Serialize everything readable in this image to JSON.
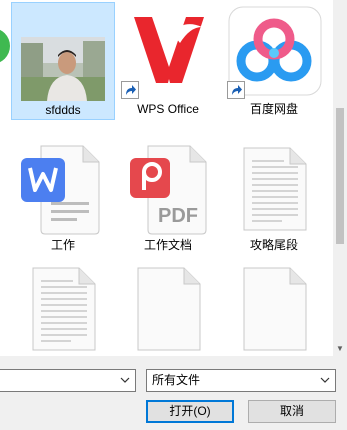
{
  "files": [
    {
      "name": "sfddds",
      "kind": "photo",
      "selected": true
    },
    {
      "name": "WPS Office",
      "kind": "app-shortcut",
      "icon": "wps-office-icon"
    },
    {
      "name": "百度网盘",
      "kind": "app-shortcut",
      "icon": "baidu-netdisk-icon"
    },
    {
      "name": "工作",
      "kind": "document",
      "icon": "wps-writer-icon"
    },
    {
      "name": "工作文档",
      "kind": "document",
      "icon": "wps-pdf-icon"
    },
    {
      "name": "攻略尾段",
      "kind": "document",
      "icon": "text-document-icon"
    },
    {
      "name": "",
      "kind": "document",
      "icon": "text-document-icon"
    },
    {
      "name": "",
      "kind": "document",
      "icon": "blank-document-icon"
    },
    {
      "name": "",
      "kind": "document",
      "icon": "blank-document-icon"
    }
  ],
  "filename_input": {
    "value": ""
  },
  "filetype_select": {
    "value": "所有文件"
  },
  "buttons": {
    "open": "打开(O)",
    "cancel": "取消"
  },
  "colors": {
    "selection_bg": "#cce8ff",
    "selection_border": "#99d1ff",
    "wps_red": "#e9262d",
    "wps_writer_blue": "#4c7ff0",
    "wps_pdf_red": "#e5484d",
    "baidu_blue": "#2a9bf1",
    "accent": "#0078d7"
  }
}
